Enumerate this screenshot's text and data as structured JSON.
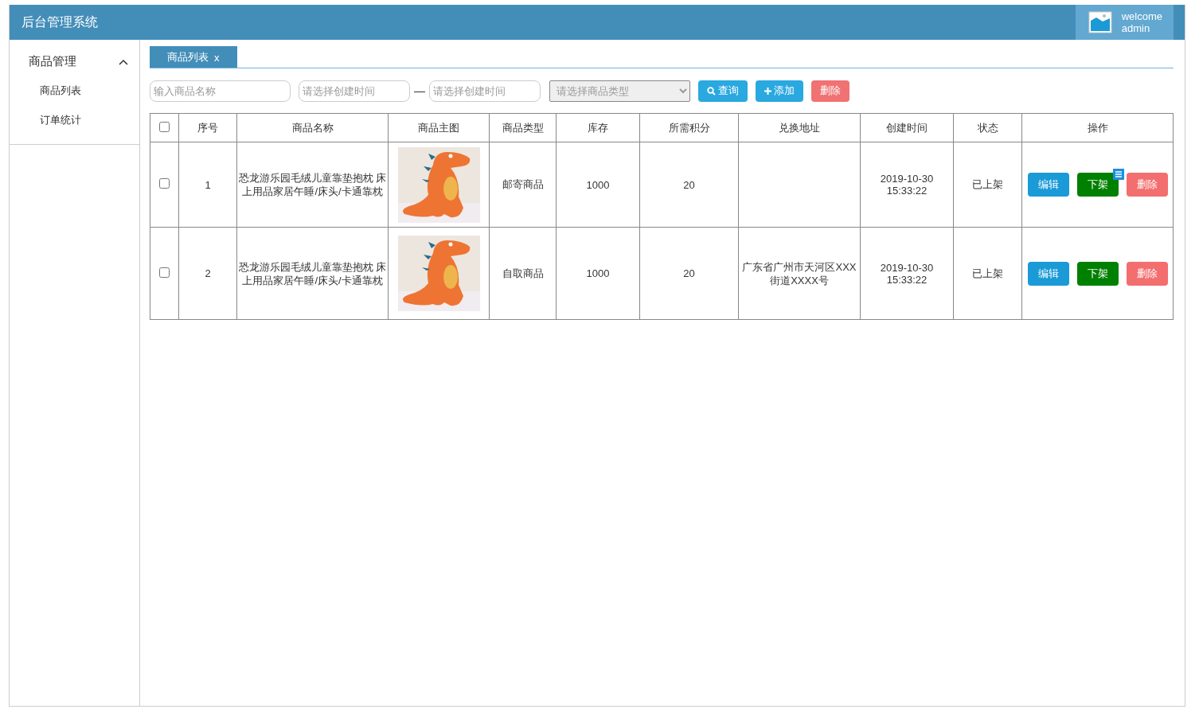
{
  "header": {
    "title": "后台管理系统",
    "user": {
      "greeting": "welcome",
      "name": "admin"
    }
  },
  "sidebar": {
    "groups": [
      {
        "label": "商品管理",
        "expanded": true,
        "items": [
          "商品列表",
          "订单统计"
        ]
      }
    ]
  },
  "tabs": [
    {
      "label": "商品列表",
      "close": "x",
      "selected": true
    }
  ],
  "filters": {
    "name": {
      "placeholder": "输入商品名称"
    },
    "date_from": {
      "placeholder": "请选择创建时间"
    },
    "separator": "—",
    "date_to": {
      "placeholder": "请选择创建时间"
    },
    "type": {
      "placeholder": "请选择商品类型"
    }
  },
  "buttons": [
    {
      "kind": "search",
      "label": "查询"
    },
    {
      "kind": "add",
      "label": "添加"
    },
    {
      "kind": "delete",
      "label": "删除"
    }
  ],
  "table": {
    "all_checked": false,
    "columns": [
      "序号",
      "商品名称",
      "商品主图",
      "商品类型",
      "库存",
      "所需积分",
      "兑换地址",
      "创建时间",
      "状态",
      "操作"
    ],
    "rows": [
      {
        "checked": false,
        "index": "1",
        "name": "恐龙游乐园毛绒儿童靠垫抱枕 床上用品家居午睡/床头/卡通靠枕",
        "type": "邮寄商品",
        "stock": "1000",
        "points": "20",
        "created": "2019-10-30 15:33:22",
        "status": "已上架",
        "actions": [
          {
            "kind": "edit",
            "label": "编辑",
            "badge": false
          },
          {
            "kind": "unlist",
            "label": "下架",
            "badge": true
          },
          {
            "kind": "delete",
            "label": "删除",
            "badge": false
          }
        ]
      },
      {
        "checked": false,
        "index": "2",
        "name": "恐龙游乐园毛绒儿童靠垫抱枕 床上用品家居午睡/床头/卡通靠枕",
        "type": "自取商品",
        "stock": "1000",
        "points": "20",
        "address": "广东省广州市天河区XXX街道XXXX号",
        "created": "2019-10-30 15:33:22",
        "status": "已上架",
        "actions": [
          {
            "kind": "edit",
            "label": "编辑",
            "badge": false
          },
          {
            "kind": "unlist",
            "label": "下架",
            "badge": false
          },
          {
            "kind": "delete",
            "label": "删除",
            "badge": false
          }
        ]
      }
    ]
  }
}
